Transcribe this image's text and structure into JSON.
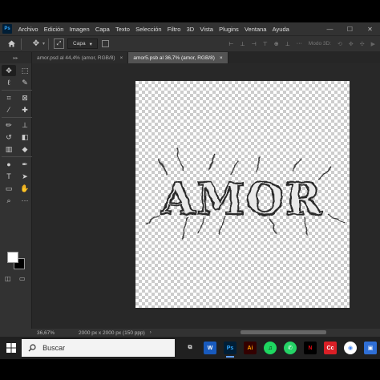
{
  "app": {
    "logo_text": "Ps",
    "menu": [
      "Archivo",
      "Edición",
      "Imagen",
      "Capa",
      "Texto",
      "Selección",
      "Filtro",
      "3D",
      "Vista",
      "Plugins",
      "Ventana",
      "Ayuda"
    ],
    "window_controls": [
      "—",
      "☐",
      "✕"
    ]
  },
  "options_bar": {
    "layer_select_value": "Capa",
    "mode_3d_label": "Modo 3D:",
    "icons": [
      "home-icon",
      "move-icon",
      "auto-select-icon",
      "align-icons",
      "distribute-icons",
      "more-icon",
      "3d-orbit-icon",
      "3d-pan-icon",
      "video-icon"
    ]
  },
  "tabs": [
    {
      "label": "amor.psd al 44,4% (amor, RGB/8)",
      "close": "×",
      "active": false
    },
    {
      "label": "amor5.psb al 36,7% (amor, RGB/8)",
      "close": "×",
      "active": true
    }
  ],
  "tools": [
    {
      "name": "move-tool",
      "glyph": "✥",
      "selected": true
    },
    {
      "name": "marquee-tool",
      "glyph": "⬚"
    },
    {
      "name": "lasso-tool",
      "glyph": "ℓ"
    },
    {
      "name": "quick-select-tool",
      "glyph": "✎"
    },
    {
      "name": "crop-tool",
      "glyph": "⌗"
    },
    {
      "name": "frame-tool",
      "glyph": "⊠"
    },
    {
      "name": "eyedropper-tool",
      "glyph": "⁄"
    },
    {
      "name": "healing-tool",
      "glyph": "✚"
    },
    {
      "name": "brush-tool",
      "glyph": "✏"
    },
    {
      "name": "stamp-tool",
      "glyph": "⊥"
    },
    {
      "name": "history-brush-tool",
      "glyph": "↺"
    },
    {
      "name": "eraser-tool",
      "glyph": "◧"
    },
    {
      "name": "gradient-tool",
      "glyph": "▥"
    },
    {
      "name": "blur-tool",
      "glyph": "◆"
    },
    {
      "name": "dodge-tool",
      "glyph": "●"
    },
    {
      "name": "pen-tool",
      "glyph": "✒"
    },
    {
      "name": "type-tool",
      "glyph": "T"
    },
    {
      "name": "path-select-tool",
      "glyph": "➤"
    },
    {
      "name": "shape-tool",
      "glyph": "▭"
    },
    {
      "name": "hand-tool",
      "glyph": "✋"
    },
    {
      "name": "zoom-tool",
      "glyph": "⌕"
    },
    {
      "name": "edit-toolbar",
      "glyph": "···"
    }
  ],
  "document": {
    "artwork_text": "AMOR"
  },
  "status": {
    "zoom": "36,67%",
    "doc_size": "2000 px x 2000 px (150 ppp)",
    "arrow": "›"
  },
  "taskbar": {
    "search_placeholder": "Buscar",
    "apps": [
      {
        "name": "task-view-icon",
        "glyph": "⧉",
        "color": "#dddddd",
        "bg": "transparent"
      },
      {
        "name": "word-icon",
        "glyph": "W",
        "color": "#ffffff",
        "bg": "#185abd"
      },
      {
        "name": "photoshop-icon",
        "glyph": "Ps",
        "color": "#31a8ff",
        "bg": "#001e36",
        "active": true
      },
      {
        "name": "illustrator-icon",
        "glyph": "Ai",
        "color": "#ff9a00",
        "bg": "#330000"
      },
      {
        "name": "spotify-icon",
        "glyph": "♫",
        "color": "#000000",
        "bg": "#1ed760"
      },
      {
        "name": "whatsapp-icon",
        "glyph": "✆",
        "color": "#ffffff",
        "bg": "#25d366"
      },
      {
        "name": "netflix-icon",
        "glyph": "N",
        "color": "#e50914",
        "bg": "#000000"
      },
      {
        "name": "adobe-cc-icon",
        "glyph": "Cc",
        "color": "#ffffff",
        "bg": "#da1f26"
      },
      {
        "name": "chrome-icon",
        "glyph": "◉",
        "color": "#4285f4",
        "bg": "#ffffff"
      },
      {
        "name": "photos-icon",
        "glyph": "▣",
        "color": "#ffffff",
        "bg": "#2f6fd6"
      }
    ]
  },
  "colors": {
    "panel_bg": "#323232",
    "workspace_bg": "#282828",
    "foreground_swatch": "#ffffff",
    "background_swatch": "#000000"
  }
}
